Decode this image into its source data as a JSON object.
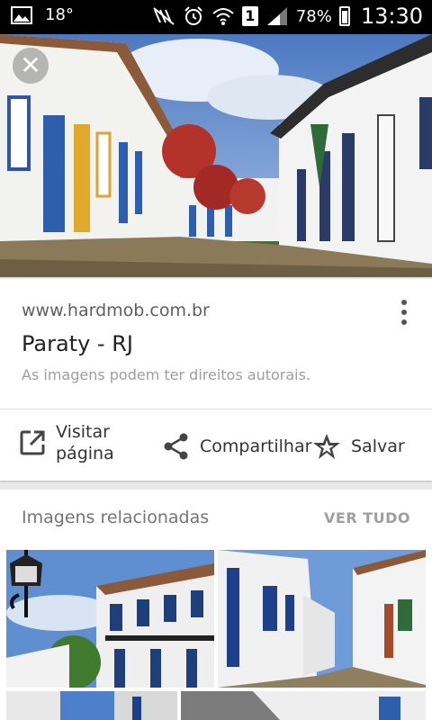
{
  "status_bar": {
    "temperature": "18°",
    "battery": "78%",
    "sim": "1",
    "time": "13:30"
  },
  "hero": {
    "alt": "Paraty - RJ"
  },
  "result": {
    "url": "www.hardmob.com.br",
    "title": "Paraty - RJ",
    "rights": "As imagens podem ter direitos autorais."
  },
  "actions": {
    "visit_line1": "Visitar",
    "visit_line2": "página",
    "share": "Compartilhar",
    "save": "Salvar"
  },
  "related": {
    "heading": "Imagens relacionadas",
    "see_all": "VER TUDO"
  }
}
